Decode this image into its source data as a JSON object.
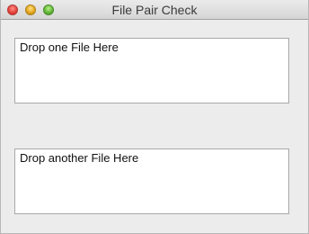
{
  "window": {
    "title": "File Pair Check",
    "controls": [
      "close",
      "minimize",
      "zoom"
    ]
  },
  "drop_zones": [
    {
      "label": "Drop one File Here"
    },
    {
      "label": "Drop another File Here"
    }
  ]
}
